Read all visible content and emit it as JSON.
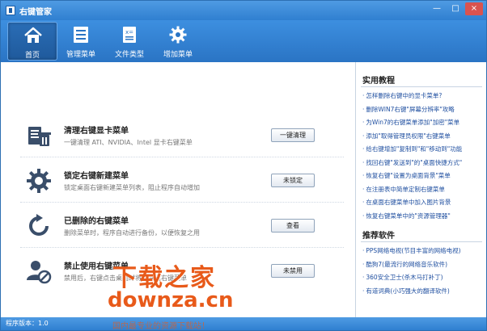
{
  "window": {
    "title": "右键管家",
    "min_label": "—",
    "max_label": "□",
    "close_label": "×"
  },
  "toolbar": {
    "items": [
      {
        "label": "首页",
        "icon": "home-icon",
        "active": true
      },
      {
        "label": "管理菜单",
        "icon": "menu-list-icon",
        "active": false
      },
      {
        "label": "文件类型",
        "icon": "file-type-icon",
        "active": false
      },
      {
        "label": "增加菜单",
        "icon": "gear-icon",
        "active": false
      }
    ]
  },
  "features": [
    {
      "title": "清理右键显卡菜单",
      "desc": "一键清理 ATI、NVIDIA、Intel 显卡右键菜单",
      "button": "一键清理",
      "icon": "trash-icon"
    },
    {
      "title": "锁定右键新建菜单",
      "desc": "锁定桌面右键新建菜单列表，阻止程序自动增加",
      "button": "未锁定",
      "icon": "gear-lock-icon"
    },
    {
      "title": "已删除的右键菜单",
      "desc": "删除菜单时，程序自动进行备份，以便恢复之用",
      "button": "查看",
      "icon": "restore-icon"
    },
    {
      "title": "禁止使用右键菜单",
      "desc": "禁用后，右键点击桌面时将不弹出右键菜单",
      "button": "未禁用",
      "icon": "user-block-icon"
    }
  ],
  "sidebar": {
    "tutorials_title": "实用教程",
    "tutorials": [
      "怎样删除右键中的显卡菜单?",
      "删除WIN7右键\"屏幕分辨率\"攻略",
      "为Win7的右键菜单添加\"加密\"菜单",
      "添加\"取得管理员权限\"右键菜单",
      "给右键增加\"复制到\"和\"移动到\"功能",
      "找回右键\"发送到\"的\"桌面快捷方式\"",
      "恢复右键\"设置为桌面背景\"菜单",
      "在注册表中简单定制右键菜单",
      "在桌面右键菜单中加入图片背景",
      "恢复右键菜单中的\"资源管理器\""
    ],
    "software_title": "推荐软件",
    "software": [
      "PPS网络电视(节目丰富的网络电视)",
      "酷狗7(最流行的网络音乐软件)",
      "360安全卫士(杀木马打补丁)",
      "有道词典(小巧强大的翻译软件)"
    ]
  },
  "status": {
    "version_text": "程序版本：1.0"
  },
  "watermark": {
    "cn": "下载之家",
    "en": "downza.cn",
    "sub": "国内最专业的资源下载站！"
  },
  "colors": {
    "titlebar": "#2f7fd0",
    "toolbar": "#2a74c4",
    "link": "#1f4fa0",
    "watermark": "#e85a1a"
  }
}
